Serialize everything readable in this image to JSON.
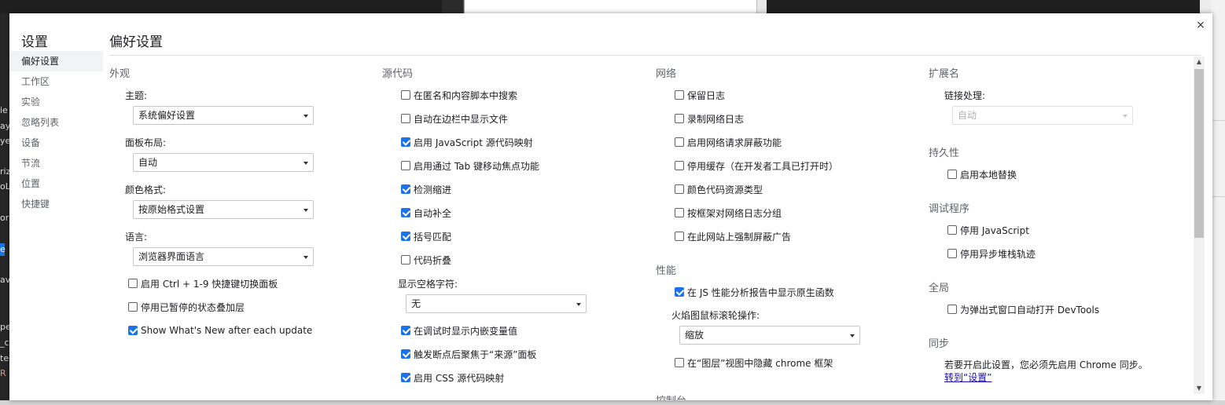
{
  "backdrop": {
    "left_fragments": [
      "ie",
      "ay",
      "ye",
      "riz",
      "oL",
      "or",
      "e",
      "ave",
      "per",
      "_c",
      "ter",
      "R"
    ]
  },
  "dialog": {
    "close_glyph": "×",
    "sidebar": {
      "title": "设置",
      "items": [
        {
          "label": "偏好设置",
          "active": true
        },
        {
          "label": "工作区",
          "active": false
        },
        {
          "label": "实验",
          "active": false
        },
        {
          "label": "忽略列表",
          "active": false
        },
        {
          "label": "设备",
          "active": false
        },
        {
          "label": "节流",
          "active": false
        },
        {
          "label": "位置",
          "active": false
        },
        {
          "label": "快捷键",
          "active": false
        }
      ]
    },
    "page_title": "偏好设置",
    "appearance": {
      "title": "外观",
      "theme_label": "主题:",
      "theme_value": "系统偏好设置",
      "panel_layout_label": "面板布局:",
      "panel_layout_value": "自动",
      "color_format_label": "颜色格式:",
      "color_format_value": "按原始格式设置",
      "language_label": "语言:",
      "language_value": "浏览器界面语言",
      "checkboxes": [
        {
          "label": "启用 Ctrl + 1-9 快捷键切换面板",
          "checked": false
        },
        {
          "label": "停用已暂停的状态叠加层",
          "checked": false
        },
        {
          "label": "Show What's New after each update",
          "checked": true
        }
      ]
    },
    "sources": {
      "title": "源代码",
      "checkboxes": [
        {
          "label": "在匿名和内容脚本中搜索",
          "checked": false
        },
        {
          "label": "自动在边栏中显示文件",
          "checked": false
        },
        {
          "label": "启用 JavaScript 源代码映射",
          "checked": true
        },
        {
          "label": "启用通过 Tab 键移动焦点功能",
          "checked": false
        },
        {
          "label": "检测缩进",
          "checked": true
        },
        {
          "label": "自动补全",
          "checked": true
        },
        {
          "label": "括号匹配",
          "checked": true
        },
        {
          "label": "代码折叠",
          "checked": false
        }
      ],
      "whitespace_label": "显示空格字符:",
      "whitespace_value": "无",
      "checkboxes2": [
        {
          "label": "在调试时显示内嵌变量值",
          "checked": true
        },
        {
          "label": "触发断点后聚焦于“来源”面板",
          "checked": true
        },
        {
          "label": "启用 CSS 源代码映射",
          "checked": true
        }
      ]
    },
    "network": {
      "title": "网络",
      "checkboxes": [
        {
          "label": "保留日志",
          "checked": false
        },
        {
          "label": "录制网络日志",
          "checked": false
        },
        {
          "label": "启用网络请求屏蔽功能",
          "checked": false
        },
        {
          "label": "停用缓存（在开发者工具已打开时）",
          "checked": false
        },
        {
          "label": "颜色代码资源类型",
          "checked": false
        },
        {
          "label": "按框架对网络日志分组",
          "checked": false
        },
        {
          "label": "在此网站上强制屏蔽广告",
          "checked": false
        }
      ]
    },
    "performance": {
      "title": "性能",
      "checkbox": {
        "label": "在 JS 性能分析报告中显示原生函数",
        "checked": true
      },
      "flamechart_label": "火焰图鼠标滚轮操作:",
      "flamechart_value": "缩放",
      "checkbox2": {
        "label": "在“图层”视图中隐藏 chrome 框架",
        "checked": false
      },
      "next_section_cut": "控制台"
    },
    "extensions": {
      "title": "扩展名",
      "link_handling_label": "链接处理:",
      "link_handling_value": "自动"
    },
    "persistence": {
      "title": "持久性",
      "checkbox": {
        "label": "启用本地替换",
        "checked": false
      }
    },
    "debugger": {
      "title": "调试程序",
      "checkboxes": [
        {
          "label": "停用 JavaScript",
          "checked": false
        },
        {
          "label": "停用异步堆栈轨迹",
          "checked": false
        }
      ]
    },
    "global": {
      "title": "全局",
      "checkbox": {
        "label": "为弹出式窗口自动打开 DevTools",
        "checked": false
      }
    },
    "sync": {
      "title": "同步",
      "text": "若要开启此设置，您必须先启用 Chrome 同步。",
      "link": "转到“设置”"
    }
  }
}
